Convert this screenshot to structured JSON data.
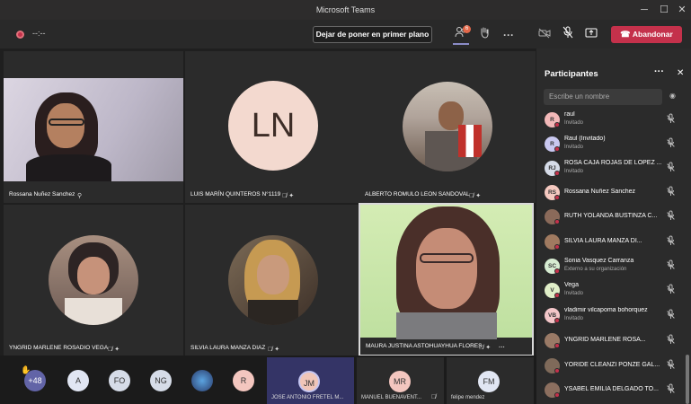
{
  "window": {
    "title": "Microsoft Teams",
    "minimize": "─",
    "maximize": "☐",
    "close": "✕"
  },
  "toolbar": {
    "timer": "--:--",
    "unpin_label": "Dejar de poner en primer plano",
    "people_badge": "6",
    "leave_label": "Abandonar",
    "icons": [
      "record-icon",
      "people-icon",
      "raise-hand-icon",
      "more-icon",
      "camera-off-icon",
      "mic-off-icon",
      "share-icon",
      "hang-up-icon"
    ]
  },
  "tiles": [
    {
      "name": "Rossana Nuñez Sanchez",
      "type": "video"
    },
    {
      "name": "LUIS MARÍN QUINTEROS N°1119",
      "initials": "LN",
      "type": "avatar"
    },
    {
      "name": "ALBERTO ROMULO LEON SANDOVAL",
      "type": "photo"
    },
    {
      "name": "YNGRID MARLENE ROSADIO VEGA",
      "type": "photo"
    },
    {
      "name": "SILVIA LAURA MANZA DIAZ",
      "type": "photo"
    },
    {
      "name": "MAURA JUSTINA ASTOHUAYHUA FLORES",
      "type": "video",
      "more": "···"
    }
  ],
  "strip": {
    "overflow": "+48",
    "avatars": [
      "A",
      "FO",
      "NG",
      "",
      "R"
    ],
    "named": [
      {
        "initials": "JM",
        "name": "JOSE ANTONIO FRETEL M..."
      },
      {
        "initials": "MR",
        "name": "MANUEL BUENAVENT..."
      },
      {
        "initials": "FM",
        "name": "felipe mendez"
      }
    ]
  },
  "panel": {
    "title": "Participantes",
    "more": "···",
    "close": "✕",
    "search_placeholder": "Escribe un nombre",
    "participants": [
      {
        "initials": "R",
        "name": "raul",
        "sub": "Invitado",
        "color": "#f2b8b8"
      },
      {
        "initials": "R",
        "name": "Raul (Invitado)",
        "sub": "Invitado",
        "color": "#c9c8f0"
      },
      {
        "initials": "RJ",
        "name": "ROSA CAJA ROJAS DE LOPEZ ...",
        "sub": "Invitado",
        "color": "#d6dce8"
      },
      {
        "initials": "RS",
        "name": "Rossana Nuñez Sanchez",
        "sub": "",
        "color": "#f5c9c0"
      },
      {
        "initials": "",
        "name": "RUTH YOLANDA BUSTINZA C...",
        "sub": "",
        "color": "#8a6a5a"
      },
      {
        "initials": "",
        "name": "SILVIA LAURA MANZA DI...",
        "sub": "",
        "color": "#a07a60"
      },
      {
        "initials": "SC",
        "name": "Sonia Vasquez Carranza",
        "sub": "Externo a su organización",
        "color": "#d7ecd2"
      },
      {
        "initials": "V",
        "name": "Vega",
        "sub": "Invitado",
        "color": "#e0eec8"
      },
      {
        "initials": "VB",
        "name": "vladimir vilcapoma bohorquez",
        "sub": "Invitado",
        "color": "#f3c6c9"
      },
      {
        "initials": "",
        "name": "YNGRID MARLENE ROSA...",
        "sub": "",
        "color": "#9a7a66"
      },
      {
        "initials": "",
        "name": "YORIDE CLEANZI PONZE GAL...",
        "sub": "",
        "color": "#7f6a5a"
      },
      {
        "initials": "",
        "name": "YSABEL EMILIA DELGADO TO...",
        "sub": "",
        "color": "#8c6f5f"
      }
    ]
  },
  "colors": {
    "accent": "#6264a7",
    "leave": "#c4314b",
    "bg": "#1f1f1f",
    "tile": "#2b2b2b"
  }
}
